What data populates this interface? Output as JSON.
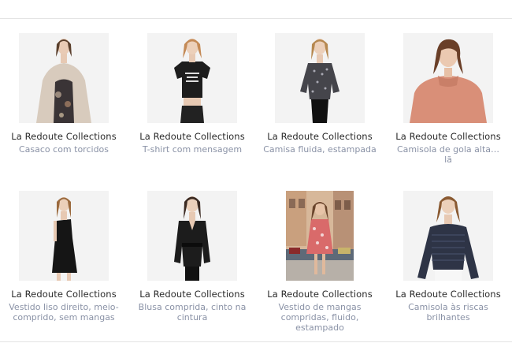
{
  "products": [
    {
      "brand": "La Redoute Collections",
      "title": "Casaco com torcidos",
      "image": "woman-knit-cardigan-photo"
    },
    {
      "brand": "La Redoute Collections",
      "title": "T-shirt com mensagem",
      "image": "woman-message-tshirt-photo"
    },
    {
      "brand": "La Redoute Collections",
      "title": "Camisa fluida, estampada",
      "image": "woman-printed-shirt-photo"
    },
    {
      "brand": "La Redoute Collections",
      "title_line1": "Camisola de gola alta…",
      "title_line2": "lã",
      "image": "woman-turtleneck-sweater-photo"
    },
    {
      "brand": "La Redoute Collections",
      "title": "Vestido liso direito, meio-comprido, sem mangas",
      "image": "woman-black-dress-photo"
    },
    {
      "brand": "La Redoute Collections",
      "title": "Blusa comprida, cinto na cintura",
      "image": "woman-belted-blouse-photo"
    },
    {
      "brand": "La Redoute Collections",
      "title": "Vestido de mangas compridas, fluido, estampado",
      "image": "woman-floral-dress-street-photo"
    },
    {
      "brand": "La Redoute Collections",
      "title": "Camisola às riscas brilhantes",
      "image": "woman-striped-sweater-photo"
    }
  ]
}
